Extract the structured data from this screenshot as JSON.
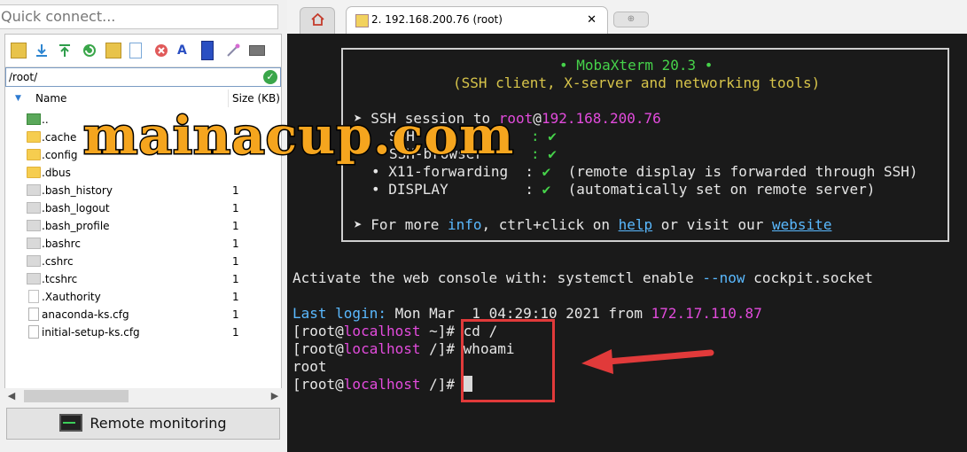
{
  "left": {
    "quick_connect_placeholder": "Quick connect...",
    "path": "/root/",
    "columns": {
      "name": "Name",
      "size": "Size (KB)"
    },
    "files": [
      {
        "name": "..",
        "size": "",
        "type": "up"
      },
      {
        "name": ".cache",
        "size": "",
        "type": "folder"
      },
      {
        "name": ".config",
        "size": "",
        "type": "folder"
      },
      {
        "name": ".dbus",
        "size": "",
        "type": "folder"
      },
      {
        "name": ".bash_history",
        "size": "1",
        "type": "file"
      },
      {
        "name": ".bash_logout",
        "size": "1",
        "type": "file"
      },
      {
        "name": ".bash_profile",
        "size": "1",
        "type": "file"
      },
      {
        "name": ".bashrc",
        "size": "1",
        "type": "file"
      },
      {
        "name": ".cshrc",
        "size": "1",
        "type": "file"
      },
      {
        "name": ".tcshrc",
        "size": "1",
        "type": "file"
      },
      {
        "name": ".Xauthority",
        "size": "1",
        "type": "file-white"
      },
      {
        "name": "anaconda-ks.cfg",
        "size": "1",
        "type": "cfg"
      },
      {
        "name": "initial-setup-ks.cfg",
        "size": "1",
        "type": "cfg"
      }
    ],
    "remote_monitoring": "Remote monitoring"
  },
  "watermark": "mainacup.com",
  "tabs": {
    "ssh_tab_title": "2. 192.168.200.76 (root)",
    "close_glyph": "✕"
  },
  "terminal": {
    "banner_title": "• MobaXterm 20.3 •",
    "banner_subtitle": "(SSH client, X-server and networking tools)",
    "session_prefix": "➤ SSH session to ",
    "session_user": "root",
    "session_at": "@",
    "session_host": "192.168.200.76",
    "ssh_line_partial": "SSH",
    "ssh_line_partial2": "SSH-browser",
    "colon_check": ": ✔",
    "x11_line": "• X11-forwarding  : ",
    "x11_check": "✔",
    "x11_note": "  (remote display is forwarded through SSH)",
    "display_line": "• DISPLAY         : ",
    "display_check": "✔",
    "display_note": "  (automatically set on remote server)",
    "info_prefix": "➤ For more ",
    "info_word": "info",
    "info_mid": ", ctrl+click on ",
    "help_word": "help",
    "info_mid2": " or visit our ",
    "website_word": "website",
    "activate_prefix": "Activate the web console with: systemctl enable ",
    "activate_flag": "--now",
    "activate_suffix": " cockpit.socket",
    "last_login_label": "Last login:",
    "last_login_date": " Mon Mar  1 04:29:10 2021 from ",
    "last_login_ip": "172.17.110.87",
    "prompt_open": "[root@",
    "prompt_host": "localhost",
    "cmd1_dir": " ~]# ",
    "cmd1": "cd /",
    "cmd2_dir": " /]# ",
    "cmd2": "whoami",
    "output": "root",
    "cmd3_dir": " /]# "
  },
  "colors": {
    "green": "#46d24a",
    "yellow": "#d7c44a",
    "magenta": "#e24bdc",
    "cyan": "#5ab9ff",
    "annotation_red": "#e13a3a",
    "watermark_orange": "#f5a51e"
  }
}
